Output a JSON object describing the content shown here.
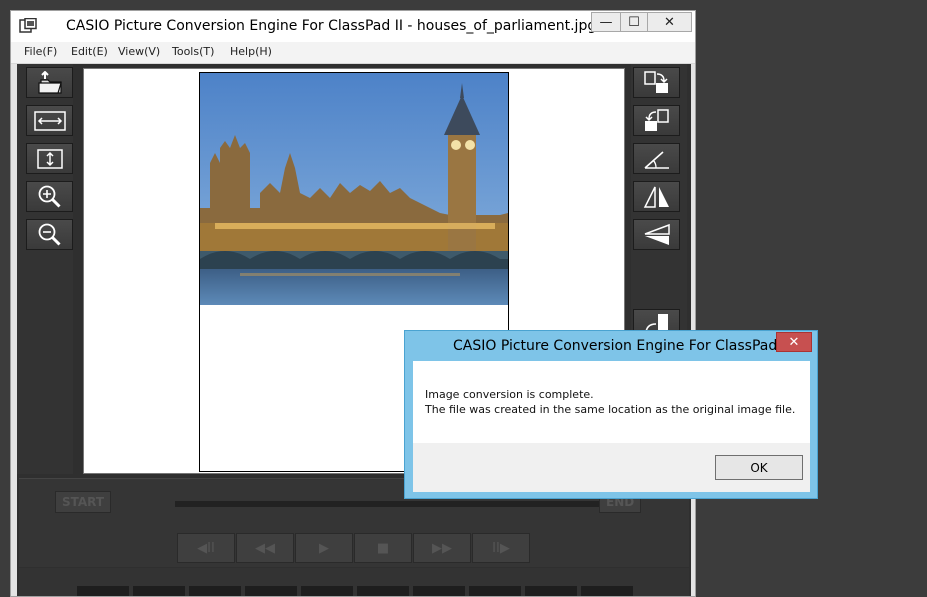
{
  "window": {
    "title": "CASIO Picture Conversion Engine For ClassPad II - houses_of_parliament.jpg",
    "minimize_glyph": "—",
    "maximize_glyph": "☐",
    "close_glyph": "✕"
  },
  "menu": [
    {
      "label": "File(F)"
    },
    {
      "label": "Edit(E)"
    },
    {
      "label": "View(V)"
    },
    {
      "label": "Tools(T)"
    },
    {
      "label": "Help(H)"
    }
  ],
  "left_tools": [
    {
      "icon": "open-folder-icon"
    },
    {
      "icon": "fit-width-icon"
    },
    {
      "icon": "fit-height-icon"
    },
    {
      "icon": "zoom-in-icon"
    },
    {
      "icon": "zoom-out-icon"
    }
  ],
  "right_tools": [
    {
      "icon": "rotate-clockwise-icon"
    },
    {
      "icon": "rotate-counterclockwise-icon"
    },
    {
      "icon": "free-rotate-icon"
    },
    {
      "icon": "flip-horizontal-icon"
    },
    {
      "icon": "flip-vertical-icon"
    },
    {
      "icon": "convert-icon"
    }
  ],
  "player": {
    "start_label": "START",
    "end_label": "END",
    "controls": [
      {
        "glyph": "◀II",
        "icon": "prev-frame-icon"
      },
      {
        "glyph": "◀◀",
        "icon": "rewind-icon"
      },
      {
        "glyph": "▶",
        "icon": "play-icon"
      },
      {
        "glyph": "■",
        "icon": "stop-icon"
      },
      {
        "glyph": "▶▶",
        "icon": "fast-forward-icon"
      },
      {
        "glyph": "II▶",
        "icon": "next-frame-icon"
      }
    ]
  },
  "dialog": {
    "title": "CASIO Picture Conversion Engine For ClassPad II",
    "close_glyph": "✕",
    "line1": "Image conversion is complete.",
    "line2": "The file was created in the same location as the original image file.",
    "ok_label": "OK"
  },
  "colors": {
    "dialog_frame": "#7ec4e8",
    "close_red": "#c75050",
    "app_dark": "#2f2f2f"
  }
}
